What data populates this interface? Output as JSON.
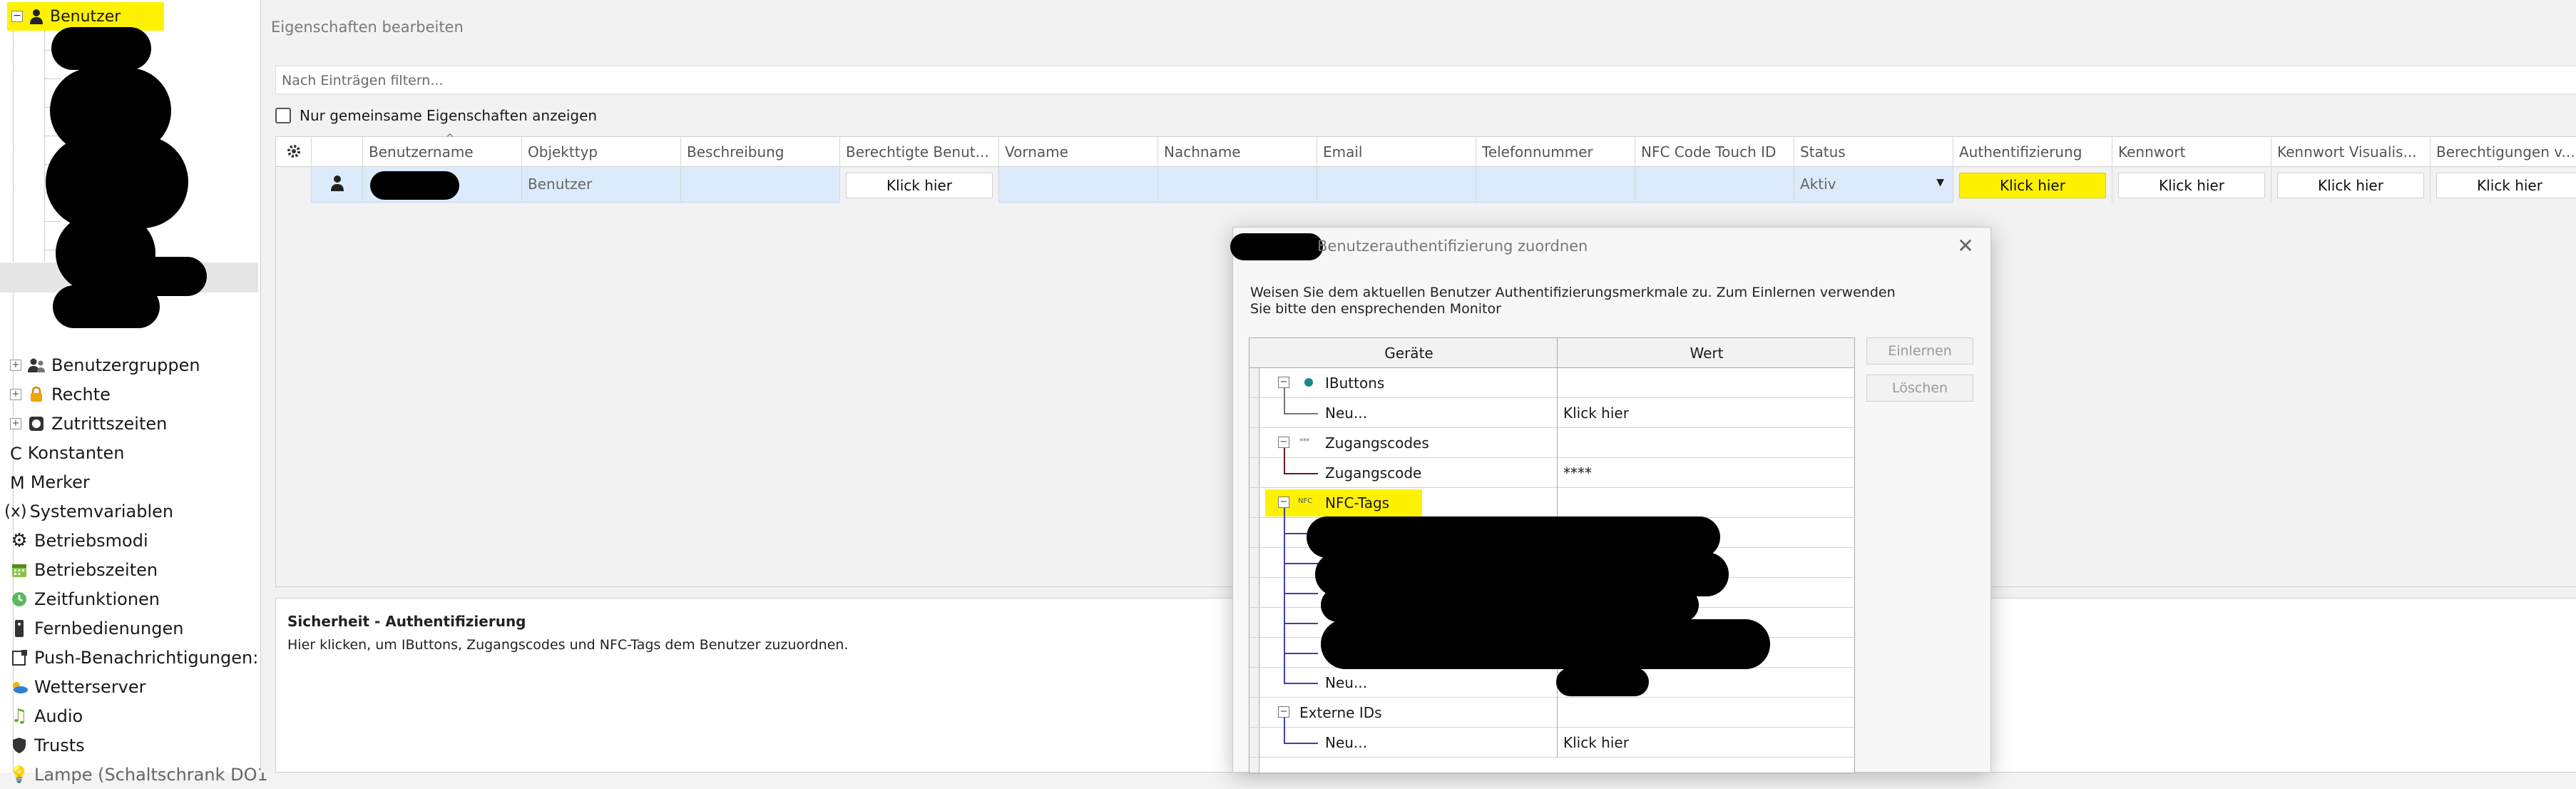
{
  "tree": {
    "root": {
      "label": "Benutzer"
    },
    "items": [
      {
        "label": "Benutzergruppen",
        "icon": "users-icon",
        "expandable": true
      },
      {
        "label": "Rechte",
        "icon": "lock-icon",
        "expandable": true
      },
      {
        "label": "Zutrittszeiten",
        "icon": "clock-icon",
        "expandable": true
      },
      {
        "label": "Konstanten",
        "prefix": "C",
        "icon": "constant-icon"
      },
      {
        "label": "Merker",
        "prefix": "M",
        "icon": "flag-marker-icon"
      },
      {
        "label": "Systemvariablen",
        "prefix": "(x)",
        "icon": "variable-icon"
      },
      {
        "label": "Betriebsmodi",
        "icon": "gear-icon"
      },
      {
        "label": "Betriebszeiten",
        "icon": "calendar-icon"
      },
      {
        "label": "Zeitfunktionen",
        "icon": "timer-icon"
      },
      {
        "label": "Fernbedienungen",
        "icon": "remote-icon"
      },
      {
        "label": "Push-Benachrichtigungen: P",
        "icon": "notification-icon"
      },
      {
        "label": "Wetterserver",
        "icon": "weather-icon"
      },
      {
        "label": "Audio",
        "icon": "music-icon"
      },
      {
        "label": "Trusts",
        "icon": "shield-icon"
      },
      {
        "label": "Lampe (Schaltschrank DO1",
        "icon": "lamp-icon"
      }
    ]
  },
  "props": {
    "title": "Eigenschaften bearbeiten",
    "filter_placeholder": "Nach Einträgen filtern...",
    "common_only_label": "Nur gemeinsame Eigenschaften anzeigen",
    "columns": [
      "Benutzername",
      "Objekttyp",
      "Beschreibung",
      "Berechtigte Benut...",
      "Vorname",
      "Nachname",
      "Email",
      "Telefonnummer",
      "NFC Code Touch ID",
      "Status",
      "Authentifizierung",
      "Kennwort",
      "Kennwort Visualis...",
      "Berechtigungen v..."
    ],
    "row": {
      "objekttyp": "Benutzer",
      "berechtigte": "Klick hier",
      "status": "Aktiv",
      "authentifizierung": "Klick hier",
      "kennwort": "Klick hier",
      "kennwort_vis": "Klick hier",
      "berechtigungen": "Klick hier"
    },
    "description": {
      "title": "Sicherheit - Authentifizierung",
      "text": "Hier klicken, um IButtons, Zugangscodes und NFC-Tags dem Benutzer zuzuordnen."
    }
  },
  "dialog": {
    "title": "Benutzerauthentifizierung zuordnen",
    "instruction": "Weisen Sie dem aktuellen Benutzer Authentifizierungsmerkmale zu. Zum Einlernen verwenden Sie bitte den ensprechenden Monitor",
    "col_devices": "Geräte",
    "col_value": "Wert",
    "rows": {
      "ibuttons": "IButtons",
      "ibuttons_new": "Neu...",
      "ibuttons_new_value": "Klick hier",
      "codes": "Zugangscodes",
      "code": "Zugangscode",
      "code_value": "****",
      "nfc": "NFC-Tags",
      "nfc_new": "Neu...",
      "external": "Externe IDs",
      "external_new": "Neu...",
      "external_new_value": "Klick hier"
    },
    "btn_learn": "Einlernen",
    "btn_delete": "Löschen",
    "colors": {
      "code_branch": "#6a1b1b",
      "nfc_branch": "#3f3fa8",
      "highlight": "#fff200"
    }
  }
}
